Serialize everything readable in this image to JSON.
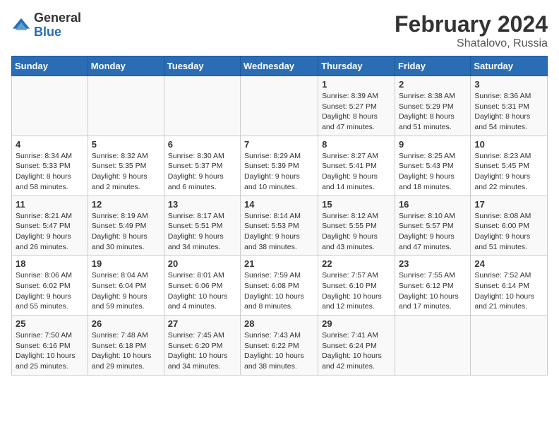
{
  "logo": {
    "general": "General",
    "blue": "Blue"
  },
  "title": {
    "month_year": "February 2024",
    "location": "Shatalovo, Russia"
  },
  "headers": [
    "Sunday",
    "Monday",
    "Tuesday",
    "Wednesday",
    "Thursday",
    "Friday",
    "Saturday"
  ],
  "weeks": [
    [
      {
        "day": "",
        "info": ""
      },
      {
        "day": "",
        "info": ""
      },
      {
        "day": "",
        "info": ""
      },
      {
        "day": "",
        "info": ""
      },
      {
        "day": "1",
        "info": "Sunrise: 8:39 AM\nSunset: 5:27 PM\nDaylight: 8 hours\nand 47 minutes."
      },
      {
        "day": "2",
        "info": "Sunrise: 8:38 AM\nSunset: 5:29 PM\nDaylight: 8 hours\nand 51 minutes."
      },
      {
        "day": "3",
        "info": "Sunrise: 8:36 AM\nSunset: 5:31 PM\nDaylight: 8 hours\nand 54 minutes."
      }
    ],
    [
      {
        "day": "4",
        "info": "Sunrise: 8:34 AM\nSunset: 5:33 PM\nDaylight: 8 hours\nand 58 minutes."
      },
      {
        "day": "5",
        "info": "Sunrise: 8:32 AM\nSunset: 5:35 PM\nDaylight: 9 hours\nand 2 minutes."
      },
      {
        "day": "6",
        "info": "Sunrise: 8:30 AM\nSunset: 5:37 PM\nDaylight: 9 hours\nand 6 minutes."
      },
      {
        "day": "7",
        "info": "Sunrise: 8:29 AM\nSunset: 5:39 PM\nDaylight: 9 hours\nand 10 minutes."
      },
      {
        "day": "8",
        "info": "Sunrise: 8:27 AM\nSunset: 5:41 PM\nDaylight: 9 hours\nand 14 minutes."
      },
      {
        "day": "9",
        "info": "Sunrise: 8:25 AM\nSunset: 5:43 PM\nDaylight: 9 hours\nand 18 minutes."
      },
      {
        "day": "10",
        "info": "Sunrise: 8:23 AM\nSunset: 5:45 PM\nDaylight: 9 hours\nand 22 minutes."
      }
    ],
    [
      {
        "day": "11",
        "info": "Sunrise: 8:21 AM\nSunset: 5:47 PM\nDaylight: 9 hours\nand 26 minutes."
      },
      {
        "day": "12",
        "info": "Sunrise: 8:19 AM\nSunset: 5:49 PM\nDaylight: 9 hours\nand 30 minutes."
      },
      {
        "day": "13",
        "info": "Sunrise: 8:17 AM\nSunset: 5:51 PM\nDaylight: 9 hours\nand 34 minutes."
      },
      {
        "day": "14",
        "info": "Sunrise: 8:14 AM\nSunset: 5:53 PM\nDaylight: 9 hours\nand 38 minutes."
      },
      {
        "day": "15",
        "info": "Sunrise: 8:12 AM\nSunset: 5:55 PM\nDaylight: 9 hours\nand 43 minutes."
      },
      {
        "day": "16",
        "info": "Sunrise: 8:10 AM\nSunset: 5:57 PM\nDaylight: 9 hours\nand 47 minutes."
      },
      {
        "day": "17",
        "info": "Sunrise: 8:08 AM\nSunset: 6:00 PM\nDaylight: 9 hours\nand 51 minutes."
      }
    ],
    [
      {
        "day": "18",
        "info": "Sunrise: 8:06 AM\nSunset: 6:02 PM\nDaylight: 9 hours\nand 55 minutes."
      },
      {
        "day": "19",
        "info": "Sunrise: 8:04 AM\nSunset: 6:04 PM\nDaylight: 9 hours\nand 59 minutes."
      },
      {
        "day": "20",
        "info": "Sunrise: 8:01 AM\nSunset: 6:06 PM\nDaylight: 10 hours\nand 4 minutes."
      },
      {
        "day": "21",
        "info": "Sunrise: 7:59 AM\nSunset: 6:08 PM\nDaylight: 10 hours\nand 8 minutes."
      },
      {
        "day": "22",
        "info": "Sunrise: 7:57 AM\nSunset: 6:10 PM\nDaylight: 10 hours\nand 12 minutes."
      },
      {
        "day": "23",
        "info": "Sunrise: 7:55 AM\nSunset: 6:12 PM\nDaylight: 10 hours\nand 17 minutes."
      },
      {
        "day": "24",
        "info": "Sunrise: 7:52 AM\nSunset: 6:14 PM\nDaylight: 10 hours\nand 21 minutes."
      }
    ],
    [
      {
        "day": "25",
        "info": "Sunrise: 7:50 AM\nSunset: 6:16 PM\nDaylight: 10 hours\nand 25 minutes."
      },
      {
        "day": "26",
        "info": "Sunrise: 7:48 AM\nSunset: 6:18 PM\nDaylight: 10 hours\nand 29 minutes."
      },
      {
        "day": "27",
        "info": "Sunrise: 7:45 AM\nSunset: 6:20 PM\nDaylight: 10 hours\nand 34 minutes."
      },
      {
        "day": "28",
        "info": "Sunrise: 7:43 AM\nSunset: 6:22 PM\nDaylight: 10 hours\nand 38 minutes."
      },
      {
        "day": "29",
        "info": "Sunrise: 7:41 AM\nSunset: 6:24 PM\nDaylight: 10 hours\nand 42 minutes."
      },
      {
        "day": "",
        "info": ""
      },
      {
        "day": "",
        "info": ""
      }
    ]
  ]
}
